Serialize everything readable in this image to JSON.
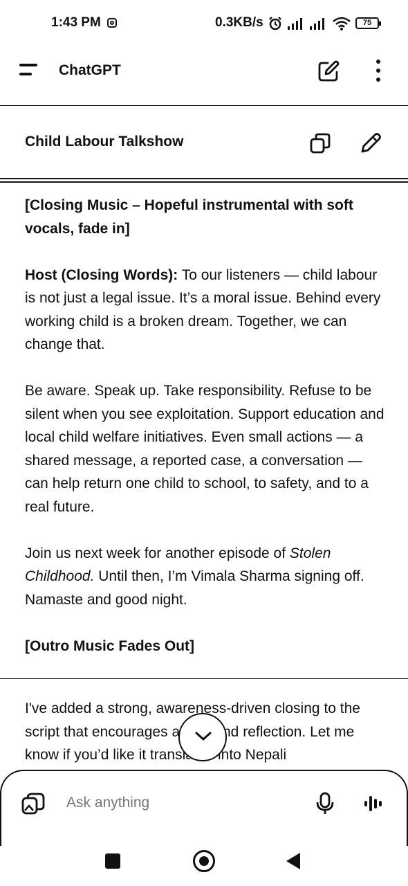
{
  "status_bar": {
    "time": "1:43 PM",
    "net_speed": "0.3KB/s",
    "battery": "75"
  },
  "app_bar": {
    "title": "ChatGPT"
  },
  "canvas": {
    "title": "Child Labour Talkshow",
    "doc": {
      "closing_music": "[Closing Music – Hopeful instrumental with soft vocals, fade in]",
      "host_label": "Host (Closing Words):",
      "host_text": " To our listeners — child labour is not just a legal issue. It’s a moral issue. Behind every working child is a broken dream. Together, we can change that.",
      "paragraph2": "Be aware. Speak up. Take responsibility. Refuse to be silent when you see exploitation. Support education and local child welfare initiatives. Even small actions — a shared message, a reported case, a conversation — can help return one child to school, to safety, and to a real future.",
      "join_prefix": "Join us next week for another episode of ",
      "join_show": "Stolen Childhood.",
      "join_suffix": " Until then, I’m Vimala Sharma signing off. Namaste and good night.",
      "outro": "[Outro Music Fades Out]"
    }
  },
  "reply": "I've added a strong, awareness-driven closing to the script that encourages action and reflection. Let me know if you’d like it translated into Nepali",
  "composer": {
    "placeholder": "Ask anything"
  }
}
